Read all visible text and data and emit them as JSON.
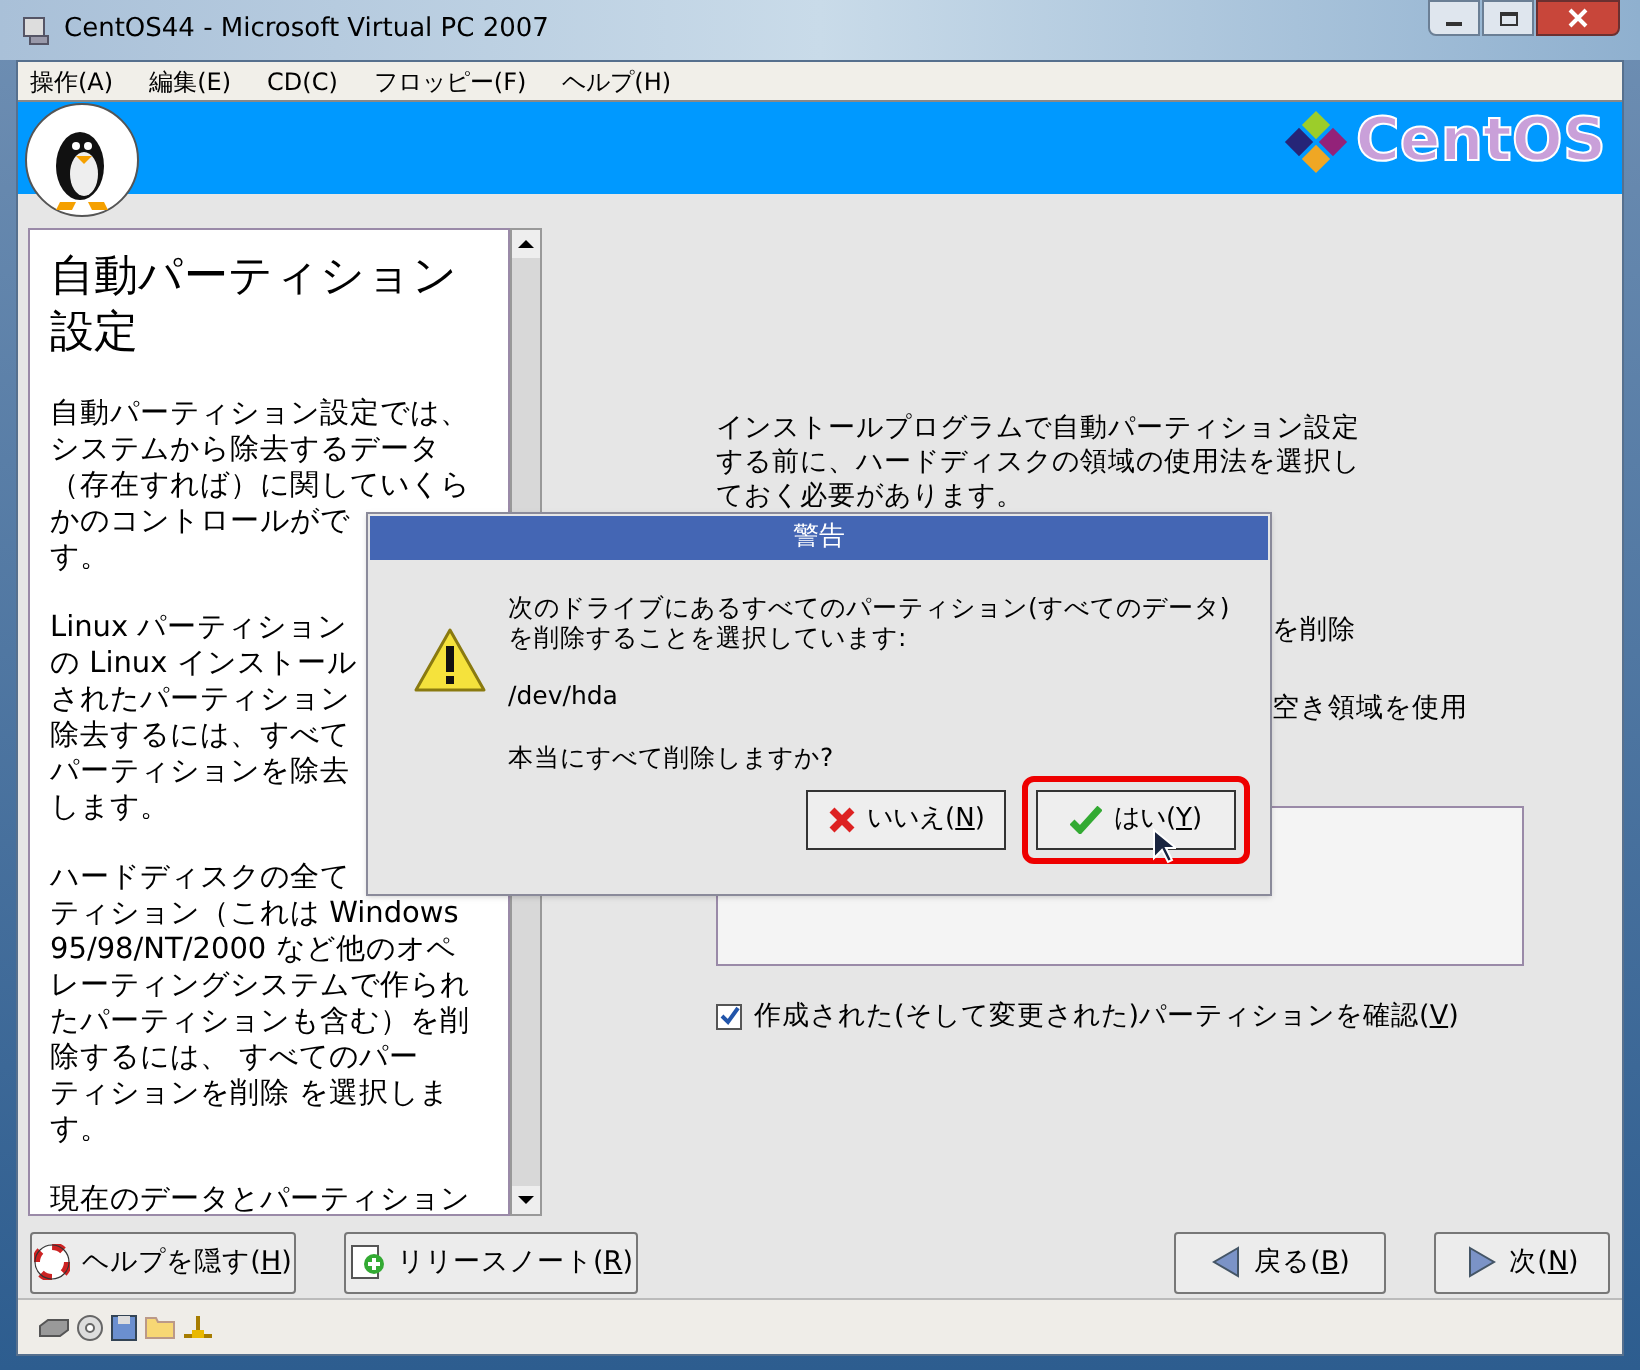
{
  "window": {
    "title": "CentOS44 - Microsoft Virtual PC 2007"
  },
  "menu": [
    "操作(A)",
    "編集(E)",
    "CD(C)",
    "フロッピー(F)",
    "ヘルプ(H)"
  ],
  "banner": {
    "logo_text": "CentOS"
  },
  "help": {
    "title": "自動パーティション設定",
    "paragraphs": [
      [
        "自動パーティション設定では、",
        "システムから除去するデータ",
        "（存在すれば）に関していくら",
        "かのコントロールがで",
        "す。"
      ],
      [
        "Linux パーティション",
        "の Linux インストール",
        "されたパーティション",
        "除去するには、すべて",
        "パーティションを除去",
        "します。"
      ],
      [
        "ハードディスクの全て",
        "ティション（これは Windows",
        "95/98/NT/2000 など他のオペ",
        "レーティングシステムで作られ",
        "たパーティションも含む）を削",
        "除するには、 すべてのパー",
        "ティションを削除 を選択しま",
        "す。"
      ],
      [
        "現在のデータとパーティション"
      ]
    ]
  },
  "content": {
    "intro": [
      "インストールプログラムで自動パーティション設定",
      "する前に、ハードディスクの領域の使用法を選択し",
      "ておく必要があります。"
    ],
    "options": [
      "を削除",
      "空き領域を使用"
    ],
    "review": {
      "label": "作成された(そして変更された)パーティションを確認(",
      "key": "V",
      "end": ")",
      "checked": true
    }
  },
  "dialog": {
    "title": "警告",
    "message": [
      "次のドライブにあるすべてのパーティション(すべてのデータ)",
      "を削除することを選択しています:"
    ],
    "device": "/dev/hda",
    "question": "本当にすべて削除しますか?",
    "buttons": [
      {
        "kind": "no",
        "label": "いいえ(",
        "key": "N",
        "end": ")",
        "highlighted": false
      },
      {
        "kind": "yes",
        "label": "はい(",
        "key": "Y",
        "end": ")",
        "highlighted": true
      }
    ]
  },
  "nav_buttons": [
    {
      "kind": "help",
      "label": "ヘルプを隠す(",
      "key": "H",
      "end": ")"
    },
    {
      "kind": "notes",
      "label": "リリースノート(",
      "key": "R",
      "end": ")"
    },
    {
      "kind": "back",
      "label": "戻る(",
      "key": "B",
      "end": ")"
    },
    {
      "kind": "next",
      "label": "次(",
      "key": "N",
      "end": ")"
    }
  ]
}
